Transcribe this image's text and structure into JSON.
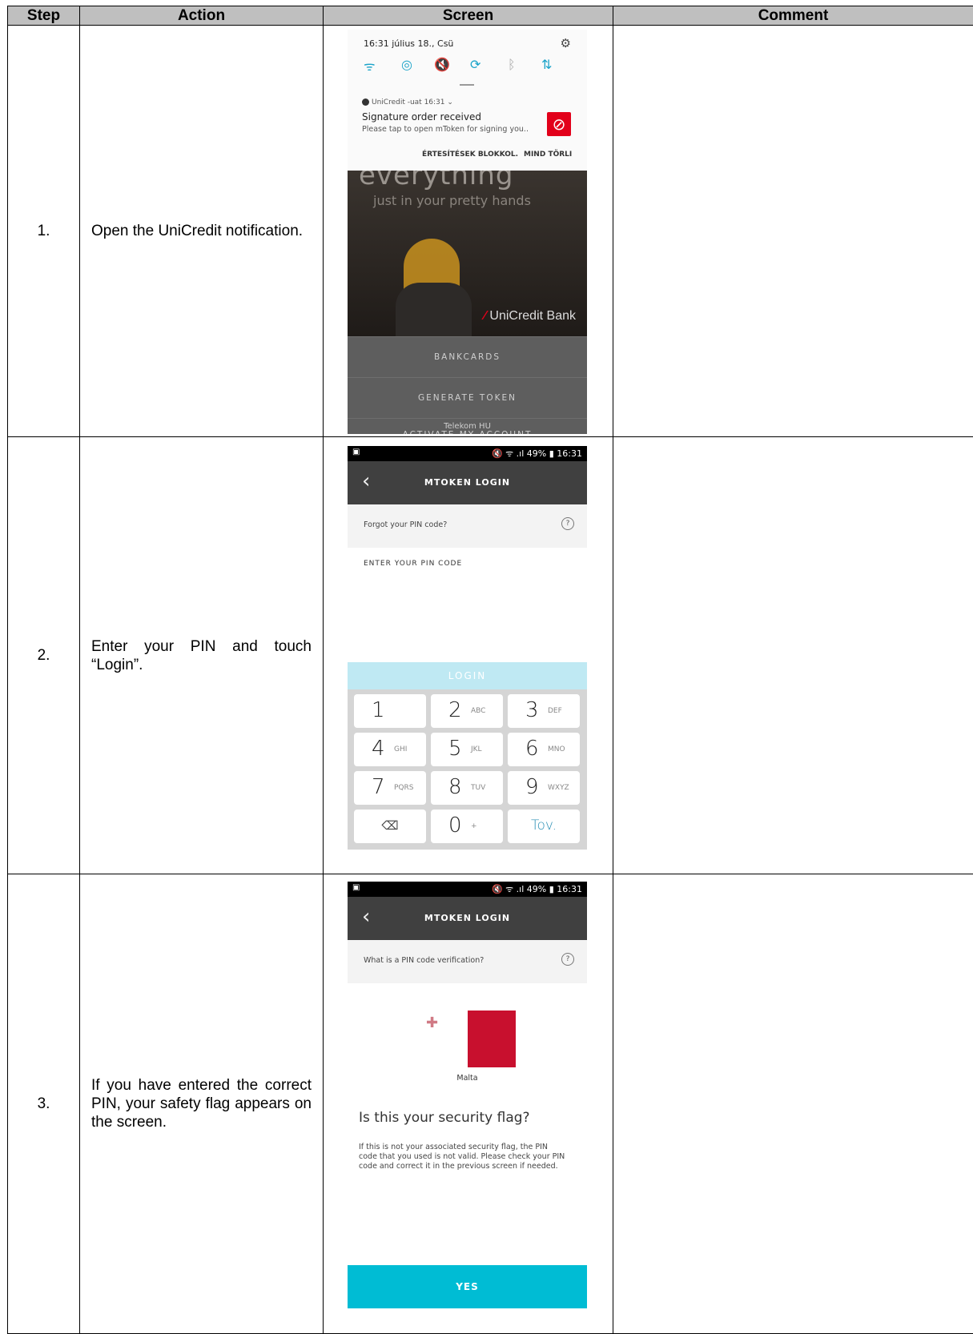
{
  "table": {
    "headers": {
      "step": "Step",
      "action": "Action",
      "screen": "Screen",
      "comment": "Comment"
    },
    "rows": [
      {
        "step": "1.",
        "action": "Open the UniCredit notification.",
        "comment": ""
      },
      {
        "step": "2.",
        "action": "Enter your PIN and touch “Login”.",
        "comment": ""
      },
      {
        "step": "3.",
        "action": "If you have entered the correct PIN, your safety flag appears on the screen.",
        "comment": ""
      }
    ]
  },
  "screen1": {
    "shade_time": "16:31   július 18., Csü",
    "notification": {
      "app": "UniCredit -uat  16:31 ⌄",
      "title": "Signature order received",
      "text": "Please tap to open mToken for signing you..",
      "action_block": "ÉRTESÍTÉSEK BLOKKOL.",
      "action_clear": "MIND TÖRLI"
    },
    "hero_big": "everything",
    "hero_sub": "just in your pretty hands",
    "bank_name": "UniCredit Bank",
    "menu": [
      "BANKCARDS",
      "GENERATE TOKEN",
      "ACTIVATE MY ACCOUNT"
    ],
    "carrier": "Telekom HU"
  },
  "status_bar": {
    "right": "🔇 ᯤ .ıl 49% ▮ 16:31"
  },
  "screen2": {
    "appbar_title": "MTOKEN LOGIN",
    "help_link": "Forgot your PIN code?",
    "pin_label": "ENTER YOUR PIN CODE",
    "login_label": "LOGIN",
    "keys": [
      {
        "n": "1",
        "s": ""
      },
      {
        "n": "2",
        "s": "ABC"
      },
      {
        "n": "3",
        "s": "DEF"
      },
      {
        "n": "4",
        "s": "GHI"
      },
      {
        "n": "5",
        "s": "JKL"
      },
      {
        "n": "6",
        "s": "MNO"
      },
      {
        "n": "7",
        "s": "PQRS"
      },
      {
        "n": "8",
        "s": "TUV"
      },
      {
        "n": "9",
        "s": "WXYZ"
      },
      {
        "n": "⌫",
        "s": ""
      },
      {
        "n": "0",
        "s": "+"
      },
      {
        "n": "Tov.",
        "s": ""
      }
    ]
  },
  "screen3": {
    "appbar_title": "MTOKEN LOGIN",
    "help_link": "What is a PIN code verification?",
    "flag_color": "#c8102e",
    "flag_name": "Malta",
    "question": "Is this your security flag?",
    "explanation": "If this is not your associated security flag, the PIN code that you used is not valid. Please check your PIN code and correct it in the previous screen if needed.",
    "yes_label": "YES"
  }
}
